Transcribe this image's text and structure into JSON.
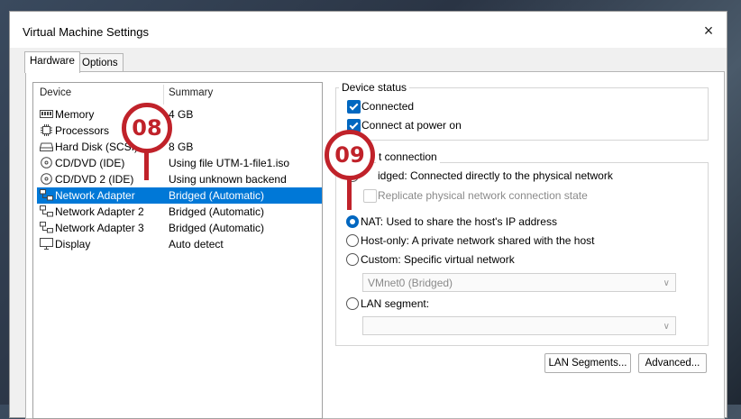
{
  "window": {
    "title": "Virtual Machine Settings",
    "close_icon": "×"
  },
  "tabs": [
    {
      "label": "Hardware",
      "active": true
    },
    {
      "label": "Options",
      "active": false
    }
  ],
  "device_list": {
    "headers": {
      "device": "Device",
      "summary": "Summary"
    },
    "rows": [
      {
        "name": "Memory",
        "summary": "4 GB",
        "icon": "memory-icon"
      },
      {
        "name": "Processors",
        "summary": "",
        "icon": "processor-icon"
      },
      {
        "name": "Hard Disk (SCSI)",
        "summary": "8 GB",
        "icon": "hard-disk-icon"
      },
      {
        "name": "CD/DVD (IDE)",
        "summary": "Using file UTM-1-file1.iso",
        "icon": "cd-dvd-icon"
      },
      {
        "name": "CD/DVD 2 (IDE)",
        "summary": "Using unknown backend",
        "icon": "cd-dvd-icon"
      },
      {
        "name": "Network Adapter",
        "summary": "Bridged (Automatic)",
        "icon": "network-adapter-icon",
        "selected": true
      },
      {
        "name": "Network Adapter 2",
        "summary": "Bridged (Automatic)",
        "icon": "network-adapter-icon"
      },
      {
        "name": "Network Adapter 3",
        "summary": "Bridged (Automatic)",
        "icon": "network-adapter-icon"
      },
      {
        "name": "Display",
        "summary": "Auto detect",
        "icon": "display-icon"
      }
    ]
  },
  "device_status": {
    "title": "Device status",
    "connected": {
      "label": "Connected",
      "checked": true
    },
    "connect_at_power_on": {
      "label": "Connect at power on",
      "checked": true
    }
  },
  "network_connection": {
    "title": "Network connection",
    "title_visible": "t connection",
    "bridged": {
      "label": "Bridged: Connected directly to the physical network",
      "label_visible": "idged: Connected directly to the physical network",
      "selected": false
    },
    "replicate": {
      "label": "Replicate physical network connection state",
      "checked": false,
      "enabled": false
    },
    "nat": {
      "label": "NAT: Used to share the host's IP address",
      "selected": true
    },
    "host_only": {
      "label": "Host-only: A private network shared with the host",
      "selected": false
    },
    "custom": {
      "label": "Custom: Specific virtual network",
      "selected": false
    },
    "custom_select": {
      "value": "VMnet0 (Bridged)"
    },
    "lan_segment": {
      "label": "LAN segment:",
      "selected": false
    },
    "lan_select": {
      "value": ""
    }
  },
  "buttons": {
    "lan_segments": "LAN Segments...",
    "advanced": "Advanced..."
  },
  "annotations": [
    {
      "label": "08",
      "color": "#c0222a"
    },
    {
      "label": "09",
      "color": "#c0222a"
    }
  ]
}
